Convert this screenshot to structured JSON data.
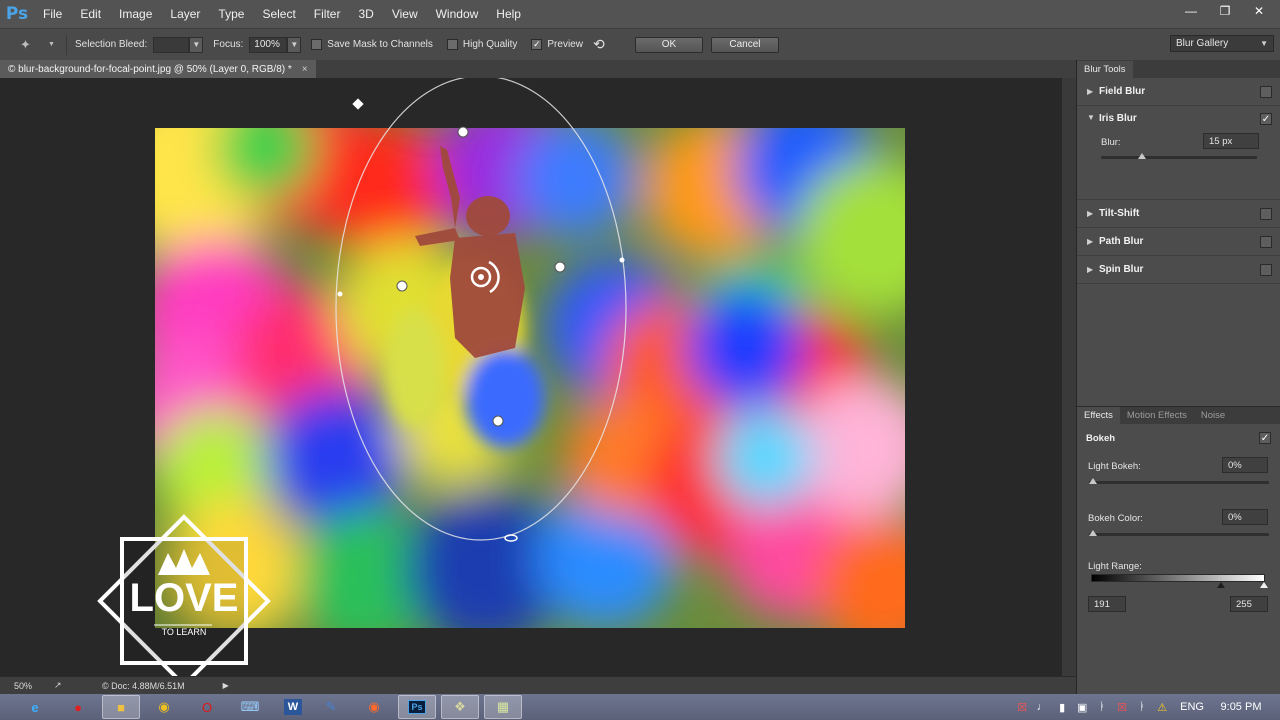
{
  "app": {
    "logo": "Ps"
  },
  "menu": [
    "File",
    "Edit",
    "Image",
    "Layer",
    "Type",
    "Select",
    "Filter",
    "3D",
    "View",
    "Window",
    "Help"
  ],
  "options": {
    "selection_bleed_label": "Selection Bleed:",
    "selection_bleed_value": "",
    "focus_label": "Focus:",
    "focus_value": "100%",
    "save_mask_label": "Save Mask to Channels",
    "high_quality_label": "High Quality",
    "preview_label": "Preview",
    "ok_label": "OK",
    "cancel_label": "Cancel",
    "workspace": "Blur Gallery"
  },
  "document": {
    "tab_title": "© blur-background-for-focal-point.jpg @ 50% (Layer 0, RGB/8) *",
    "zoom": "50%",
    "doc_size": "© Doc: 4.88M/6.51M"
  },
  "blur_tools": {
    "tab_label": "Blur Tools",
    "items": [
      {
        "name": "Field Blur",
        "expanded": false,
        "checked": false
      },
      {
        "name": "Iris Blur",
        "expanded": true,
        "checked": true
      },
      {
        "name": "Tilt-Shift",
        "expanded": false,
        "checked": false
      },
      {
        "name": "Path Blur",
        "expanded": false,
        "checked": false
      },
      {
        "name": "Spin Blur",
        "expanded": false,
        "checked": false
      }
    ],
    "blur_label": "Blur:",
    "blur_value": "15 px"
  },
  "effects": {
    "tabs": [
      "Effects",
      "Motion Effects",
      "Noise"
    ],
    "bokeh_label": "Bokeh",
    "light_bokeh_label": "Light Bokeh:",
    "light_bokeh_value": "0%",
    "bokeh_color_label": "Bokeh Color:",
    "bokeh_color_value": "0%",
    "light_range_label": "Light Range:",
    "light_range_low": "191",
    "light_range_high": "255"
  },
  "watermark": {
    "main": "LOVE",
    "sub": "TO LEARN"
  },
  "taskbar": {
    "apps": [
      "ie-icon",
      "opera-red-icon",
      "explorer-icon",
      "chrome-icon",
      "opera-icon",
      "keyboard-icon",
      "word-icon",
      "writer-icon",
      "media-icon",
      "photoshop-icon",
      "tool-icon",
      "image-icon"
    ],
    "language": "ENG",
    "time": "9:05 PM"
  },
  "colors": {
    "accent": "#4ba4e8",
    "panel": "#4c4c4c",
    "canvas": "#282828"
  }
}
